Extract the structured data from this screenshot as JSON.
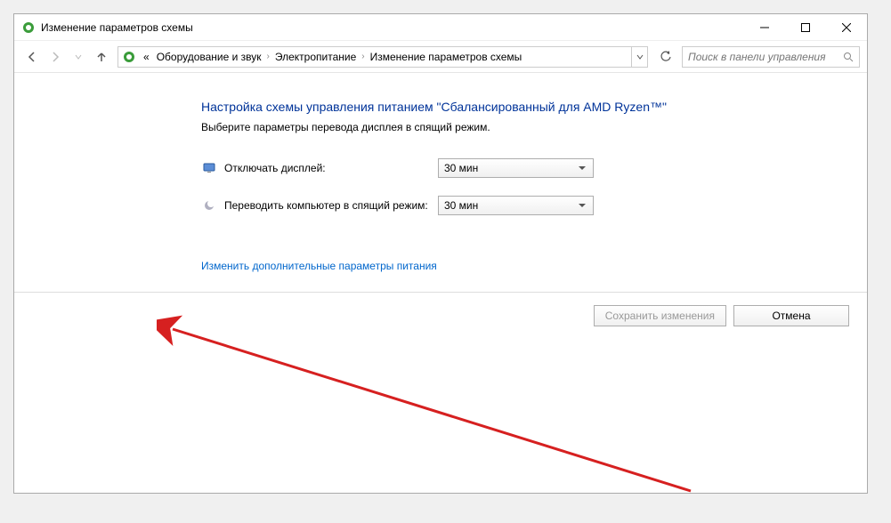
{
  "window": {
    "title": "Изменение параметров схемы"
  },
  "nav": {
    "breadcrumb_prefix": "«",
    "breadcrumb": [
      "Оборудование и звук",
      "Электропитание",
      "Изменение параметров схемы"
    ],
    "search_placeholder": "Поиск в панели управления"
  },
  "content": {
    "heading": "Настройка схемы управления питанием \"Сбалансированный для AMD Ryzen™\"",
    "subheading": "Выберите параметры перевода дисплея в спящий режим.",
    "display_off_label": "Отключать дисплей:",
    "display_off_value": "30 мин",
    "sleep_label": "Переводить компьютер в спящий режим:",
    "sleep_value": "30 мин",
    "advanced_link": "Изменить дополнительные параметры питания"
  },
  "buttons": {
    "save": "Сохранить изменения",
    "cancel": "Отмена"
  }
}
